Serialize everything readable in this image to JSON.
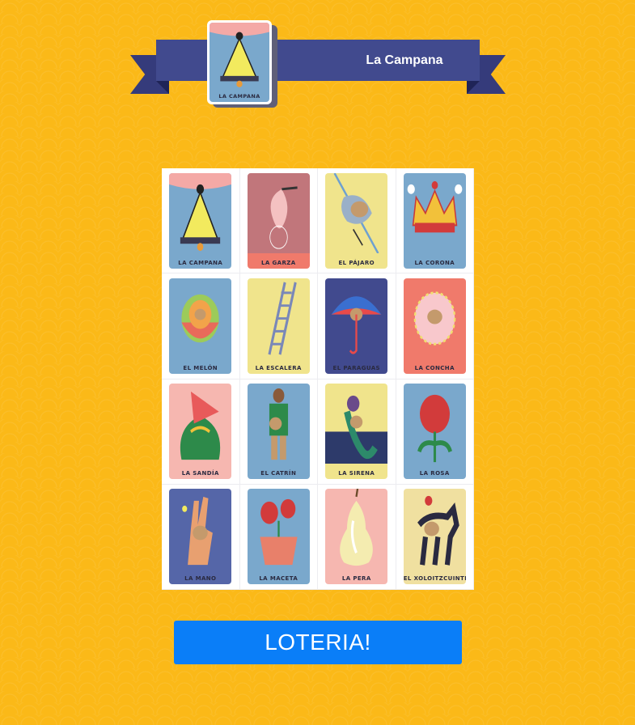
{
  "current_card": {
    "title": "La Campana",
    "label": "LA CAMPANA",
    "color": "#7aa8cc",
    "icon": "bell"
  },
  "board": {
    "cards": [
      {
        "label": "LA CAMPANA",
        "color": "#7aa8cc",
        "icon": "bell"
      },
      {
        "label": "LA GARZA",
        "color": "#f07a6b",
        "icon": "heron"
      },
      {
        "label": "EL PÁJARO",
        "color": "#f0e48c",
        "icon": "bird"
      },
      {
        "label": "LA CORONA",
        "color": "#7aa8cc",
        "icon": "crown"
      },
      {
        "label": "EL MELÓN",
        "color": "#7aa8cc",
        "icon": "melon"
      },
      {
        "label": "LA ESCALERA",
        "color": "#f0e48c",
        "icon": "ladder"
      },
      {
        "label": "EL PARAGUAS",
        "color": "#414a8e",
        "icon": "umbrella"
      },
      {
        "label": "LA CONCHA",
        "color": "#f07a6b",
        "icon": "concha"
      },
      {
        "label": "LA SANDÍA",
        "color": "#f6b7b0",
        "icon": "watermelon"
      },
      {
        "label": "EL CATRÍN",
        "color": "#7aa8cc",
        "icon": "catrin"
      },
      {
        "label": "LA SIRENA",
        "color": "#f0e48c",
        "icon": "mermaid"
      },
      {
        "label": "LA ROSA",
        "color": "#7aa8cc",
        "icon": "rose"
      },
      {
        "label": "LA MANO",
        "color": "#5566a8",
        "icon": "hand"
      },
      {
        "label": "LA MACETA",
        "color": "#7aa8cc",
        "icon": "flowerpot"
      },
      {
        "label": "LA PERA",
        "color": "#f6b7b0",
        "icon": "pear"
      },
      {
        "label": "EL XOLOITZCUINTLE",
        "color": "#f0e0a0",
        "icon": "xolo-dog"
      }
    ]
  },
  "button": {
    "label": "LOTERIA!"
  }
}
